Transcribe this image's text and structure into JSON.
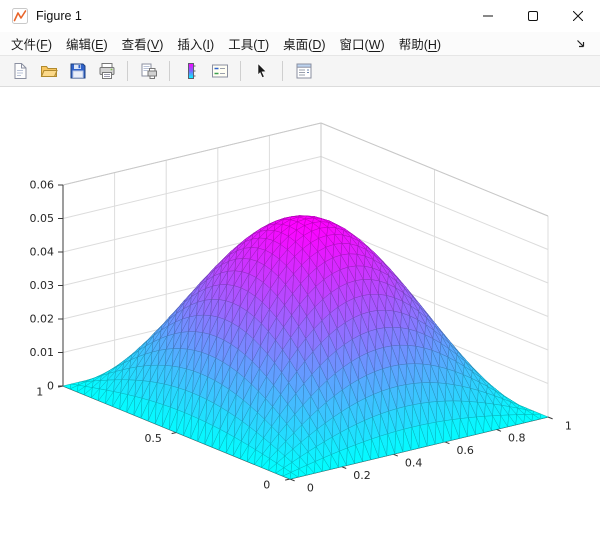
{
  "window": {
    "title": "Figure 1",
    "controls": [
      {
        "name": "minimize"
      },
      {
        "name": "maximize"
      },
      {
        "name": "close"
      }
    ]
  },
  "menu": {
    "items": [
      {
        "name": "file",
        "label": "文件",
        "key": "F"
      },
      {
        "name": "edit",
        "label": "编辑",
        "key": "E"
      },
      {
        "name": "view",
        "label": "查看",
        "key": "V"
      },
      {
        "name": "insert",
        "label": "插入",
        "key": "I"
      },
      {
        "name": "tools",
        "label": "工具",
        "key": "T"
      },
      {
        "name": "desktop",
        "label": "桌面",
        "key": "D"
      },
      {
        "name": "window",
        "label": "窗口",
        "key": "W"
      },
      {
        "name": "help",
        "label": "帮助",
        "key": "H"
      }
    ]
  },
  "toolbar": {
    "groups": [
      [
        "new-document",
        "open-folder",
        "save",
        "print"
      ],
      [
        "print-preview"
      ],
      [
        "colorbar",
        "legend"
      ],
      [
        "edit-plot-arrow"
      ],
      [
        "property-inspector"
      ]
    ]
  },
  "chart_data": {
    "type": "surface",
    "title": "",
    "function": "z = A*sin(pi*x)*sin(pi*y)",
    "amplitude": 0.0545,
    "grid_divisions": 32,
    "x_range": [
      0,
      1
    ],
    "y_range": [
      0,
      1
    ],
    "z_range": [
      0,
      0.06
    ],
    "x_ticks": [
      0,
      0.2,
      0.4,
      0.6,
      0.8,
      1
    ],
    "y_ticks": [
      0,
      0.5,
      1
    ],
    "z_ticks": [
      0,
      0.01,
      0.02,
      0.03,
      0.04,
      0.05,
      0.06
    ],
    "colormap": {
      "name": "cool",
      "low": "#00ffff",
      "high": "#ff00ff"
    },
    "view": {
      "azimuth": -37.5,
      "elevation": 30
    },
    "grid": true,
    "mesh_style": "triangulated"
  }
}
